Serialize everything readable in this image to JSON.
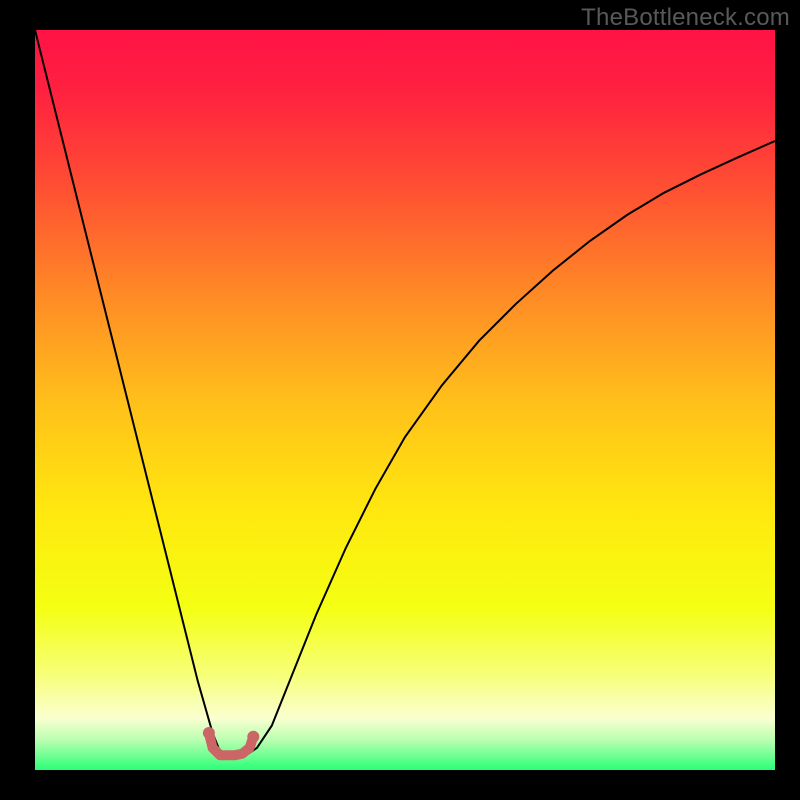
{
  "watermark": "TheBottleneck.com",
  "chart_data": {
    "type": "line",
    "title": "",
    "xlabel": "",
    "ylabel": "",
    "xlim": [
      0,
      100
    ],
    "ylim": [
      0,
      100
    ],
    "background_gradient": {
      "stops": [
        {
          "offset": 0.0,
          "color": "#ff1345"
        },
        {
          "offset": 0.08,
          "color": "#ff2040"
        },
        {
          "offset": 0.2,
          "color": "#ff4a34"
        },
        {
          "offset": 0.35,
          "color": "#ff8726"
        },
        {
          "offset": 0.5,
          "color": "#ffbf1a"
        },
        {
          "offset": 0.65,
          "color": "#ffe80f"
        },
        {
          "offset": 0.78,
          "color": "#f4ff12"
        },
        {
          "offset": 0.87,
          "color": "#f7ff77"
        },
        {
          "offset": 0.93,
          "color": "#faffd0"
        },
        {
          "offset": 0.96,
          "color": "#b8ffb0"
        },
        {
          "offset": 1.0,
          "color": "#2bff78"
        }
      ]
    },
    "series": [
      {
        "name": "bottleneck-curve",
        "stroke": "#000000",
        "stroke_width": 2,
        "x": [
          0,
          2,
          4,
          6,
          8,
          10,
          12,
          14,
          16,
          18,
          20,
          22,
          24,
          25,
          26,
          27,
          29,
          30,
          32,
          34,
          38,
          42,
          46,
          50,
          55,
          60,
          65,
          70,
          75,
          80,
          85,
          90,
          95,
          100
        ],
        "y": [
          100,
          92,
          84,
          76,
          68,
          60,
          52,
          44,
          36,
          28,
          20,
          12,
          5,
          2.5,
          2,
          2,
          2.3,
          3,
          6,
          11,
          21,
          30,
          38,
          45,
          52,
          58,
          63,
          67.5,
          71.5,
          75,
          78,
          80.5,
          82.8,
          85
        ]
      },
      {
        "name": "sweet-spot-marker",
        "stroke": "#cc6666",
        "stroke_width": 10,
        "linecap": "round",
        "x": [
          23.5,
          24,
          25,
          26,
          27,
          28,
          29,
          29.5
        ],
        "y": [
          5,
          3,
          2,
          2,
          2,
          2.2,
          3,
          4.5
        ]
      }
    ],
    "marker_dots": {
      "color": "#cc6666",
      "radius": 6,
      "points": [
        {
          "x": 23.5,
          "y": 5
        },
        {
          "x": 29.5,
          "y": 4.5
        }
      ]
    }
  }
}
